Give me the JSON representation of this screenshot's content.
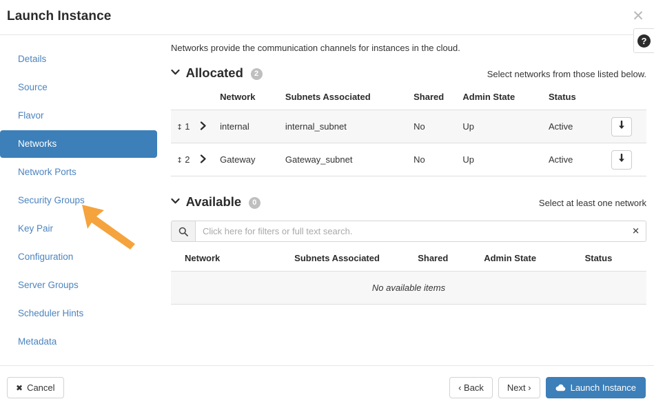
{
  "window": {
    "title": "Launch Instance",
    "close_icon": "close-icon",
    "help_icon": "help-question-icon",
    "help_label": "?"
  },
  "sidebar": {
    "items": [
      {
        "label": "Details",
        "active": false
      },
      {
        "label": "Source",
        "active": false
      },
      {
        "label": "Flavor",
        "active": false
      },
      {
        "label": "Networks",
        "active": true
      },
      {
        "label": "Network Ports",
        "active": false
      },
      {
        "label": "Security Groups",
        "active": false
      },
      {
        "label": "Key Pair",
        "active": false
      },
      {
        "label": "Configuration",
        "active": false
      },
      {
        "label": "Server Groups",
        "active": false
      },
      {
        "label": "Scheduler Hints",
        "active": false
      },
      {
        "label": "Metadata",
        "active": false
      }
    ]
  },
  "main": {
    "intro": "Networks provide the communication channels for instances in the cloud.",
    "allocated": {
      "title": "Allocated",
      "count": "2",
      "hint": "Select networks from those listed below.",
      "columns": [
        "",
        "",
        "Network",
        "Subnets Associated",
        "Shared",
        "Admin State",
        "Status",
        ""
      ],
      "rows": [
        {
          "order": "1",
          "network": "internal",
          "subnets": "internal_subnet",
          "shared": "No",
          "admin_state": "Up",
          "status": "Active",
          "action_icon": "arrow-down-icon"
        },
        {
          "order": "2",
          "network": "Gateway",
          "subnets": "Gateway_subnet",
          "shared": "No",
          "admin_state": "Up",
          "status": "Active",
          "action_icon": "arrow-down-icon"
        }
      ]
    },
    "available": {
      "title": "Available",
      "count": "0",
      "hint": "Select at least one network",
      "search_placeholder": "Click here for filters or full text search.",
      "search_value": "",
      "search_icon": "search-icon",
      "clear_icon": "clear-icon",
      "columns": [
        "Network",
        "Subnets Associated",
        "Shared",
        "Admin State",
        "Status"
      ],
      "empty_message": "No available items"
    }
  },
  "footer": {
    "cancel_label": "Cancel",
    "back_label": "‹ Back",
    "next_label": "Next ›",
    "launch_label": "Launch Instance"
  },
  "colors": {
    "accent": "#3c7fb9",
    "link": "#4c84bf",
    "annotation_arrow": "#f5a33c",
    "badge": "#bfbfbf"
  }
}
